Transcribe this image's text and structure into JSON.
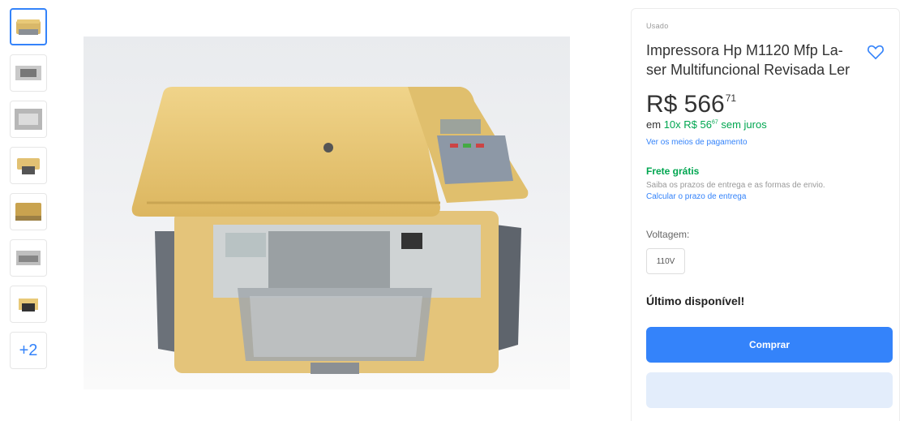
{
  "gallery": {
    "thumbnails": [
      {
        "icon": "printer-photo-front"
      },
      {
        "icon": "printer-photo-top"
      },
      {
        "icon": "printer-photo-side"
      },
      {
        "icon": "printer-photo-open"
      },
      {
        "icon": "printer-photo-angle"
      },
      {
        "icon": "printer-photo-tray"
      },
      {
        "icon": "printer-photo-back"
      }
    ],
    "more_label": "+2"
  },
  "product": {
    "condition": "Usado",
    "title": "Impressora Hp M1120 Mfp La-ser Multifuncional Revisada Ler",
    "price_whole": "R$ 566",
    "price_cents": "71",
    "installments_prefix": "em",
    "installments_value": "10x R$ 56",
    "installments_cents": "67",
    "installments_suffix": "sem juros",
    "payment_link": "Ver os meios de pagamento"
  },
  "shipping": {
    "title": "Frete grátis",
    "subtitle": "Saiba os prazos de entrega e as formas de envio.",
    "link": "Calcular o prazo de entrega"
  },
  "variation": {
    "label": "Voltagem:",
    "selected": "110V"
  },
  "stock": {
    "text": "Último disponível!"
  },
  "actions": {
    "buy_label": "Comprar",
    "cart_label": ""
  },
  "colors": {
    "accent": "#3483fa",
    "green": "#00a650",
    "printer_body": "#e8c978"
  }
}
